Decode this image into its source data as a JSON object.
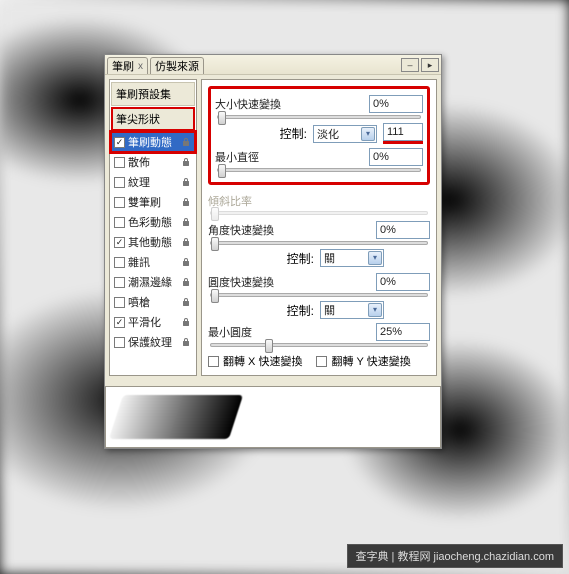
{
  "tabs": {
    "brush": "筆刷",
    "brush_x": "x",
    "clone": "仿製來源"
  },
  "sidebar": {
    "presets": "筆刷預設集",
    "tip": "筆尖形狀",
    "items": [
      {
        "label": "筆刷動態",
        "checked": true,
        "locked": true,
        "hl": true
      },
      {
        "label": "散佈",
        "checked": false,
        "locked": true
      },
      {
        "label": "紋理",
        "checked": false,
        "locked": true
      },
      {
        "label": "雙筆刷",
        "checked": false,
        "locked": true
      },
      {
        "label": "色彩動態",
        "checked": false,
        "locked": true
      },
      {
        "label": "其他動態",
        "checked": true,
        "locked": true
      },
      {
        "label": "雜訊",
        "checked": false,
        "locked": true
      },
      {
        "label": "潮濕邊緣",
        "checked": false,
        "locked": true
      },
      {
        "label": "噴槍",
        "checked": false,
        "locked": true
      },
      {
        "label": "平滑化",
        "checked": true,
        "locked": true
      },
      {
        "label": "保護紋理",
        "checked": false,
        "locked": true
      }
    ]
  },
  "main": {
    "size_jitter": {
      "label": "大小快速變換",
      "value": "0%"
    },
    "size_ctrl": {
      "label": "控制:",
      "select": "淡化",
      "value": "111"
    },
    "min_diam": {
      "label": "最小直徑",
      "value": "0%"
    },
    "tilt": {
      "label": "傾斜比率"
    },
    "angle_jitter": {
      "label": "角度快速變換",
      "value": "0%"
    },
    "angle_ctrl": {
      "label": "控制:",
      "select": "關"
    },
    "round_jitter": {
      "label": "圓度快速變換",
      "value": "0%"
    },
    "round_ctrl": {
      "label": "控制:",
      "select": "關"
    },
    "min_round": {
      "label": "最小圓度",
      "value": "25%"
    },
    "flip_x": "翻轉 X 快速變換",
    "flip_y": "翻轉 Y 快速變換"
  },
  "watermark": "查字典 | 教程网  jiaocheng.chazidian.com"
}
